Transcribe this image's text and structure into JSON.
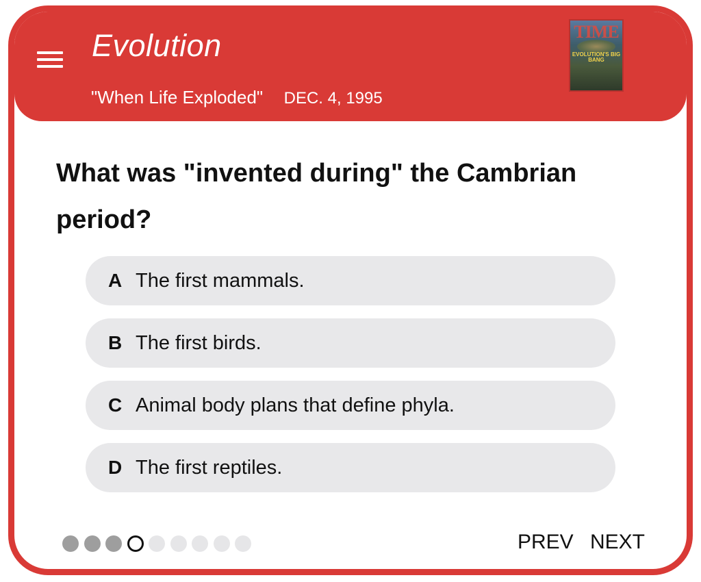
{
  "header": {
    "title": "Evolution",
    "article": "\"When Life Exploded\"",
    "date": "DEC. 4, 1995",
    "background_color": "#d93a36"
  },
  "cover": {
    "masthead": "TIME",
    "headline": "EVOLUTION'S BIG BANG"
  },
  "question": {
    "text": "What was \"invented during\" the Cambrian period?"
  },
  "options": [
    {
      "letter": "A",
      "text": "The first mammals."
    },
    {
      "letter": "B",
      "text": "The first birds."
    },
    {
      "letter": "C",
      "text": "Animal body plans that define phyla."
    },
    {
      "letter": "D",
      "text": "The first reptiles."
    }
  ],
  "progress": {
    "total": 9,
    "current": 4,
    "completed": 3
  },
  "nav": {
    "prev_label": "PREV",
    "next_label": "NEXT"
  },
  "icons": {
    "menu": "hamburger-menu-icon"
  }
}
